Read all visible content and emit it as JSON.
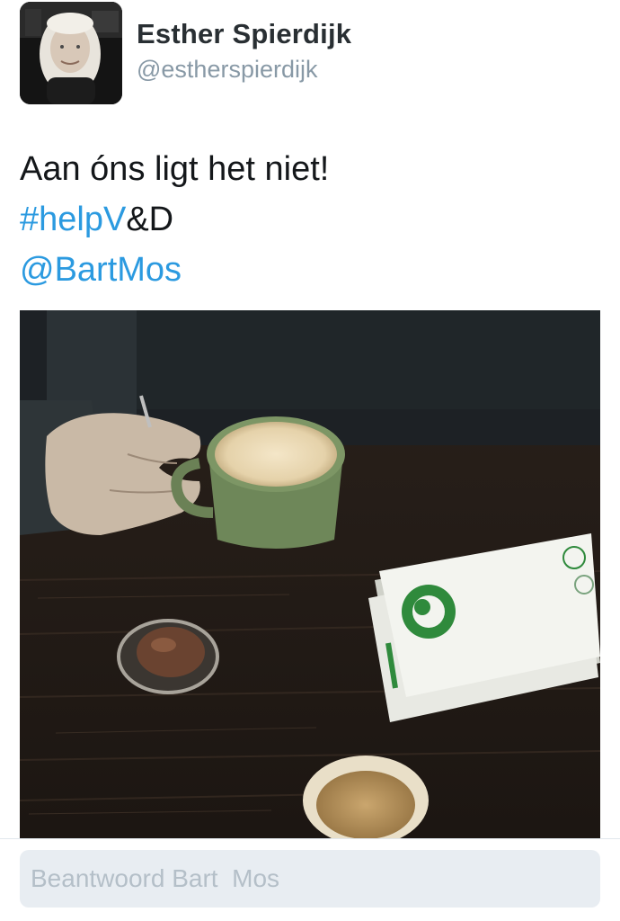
{
  "author": {
    "display_name": "Esther Spierdijk",
    "handle": "@estherspierdijk",
    "avatar_icon": "profile-photo"
  },
  "tweet": {
    "text": "Aan óns ligt het niet!",
    "hashtag_link": "#helpV",
    "hashtag_suffix": "&D",
    "mention": "@BartMos",
    "photo_icon": "attached-photo"
  },
  "reply": {
    "placeholder": "Beantwoord Bart  Mos",
    "value": ""
  },
  "colors": {
    "link": "#2b9ae0",
    "name": "#292f33",
    "handle": "#8899a6",
    "reply_background": "#e8edf2"
  }
}
